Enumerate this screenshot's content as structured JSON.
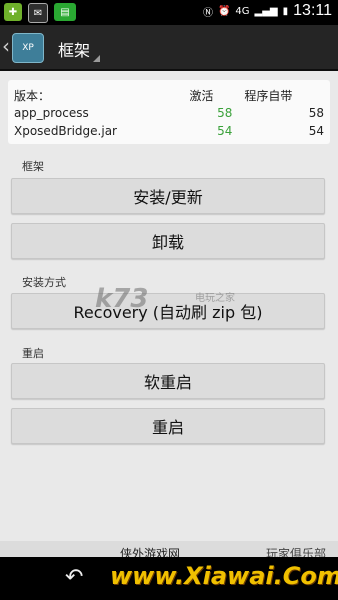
{
  "status_bar": {
    "signal_label": "4G",
    "time": "13:11",
    "icons": [
      "app-icon",
      "mail-icon",
      "news-icon",
      "nfc-icon",
      "alarm-icon",
      "signal-icon",
      "battery-icon"
    ]
  },
  "action_bar": {
    "title": "框架",
    "logo_text": "XP"
  },
  "versions": {
    "header": {
      "label": "版本：",
      "active": "激活",
      "installed": "程序自带"
    },
    "rows": [
      {
        "name": "app_process",
        "active": "58",
        "installed": "58"
      },
      {
        "name": "XposedBridge.jar",
        "active": "54",
        "installed": "54"
      }
    ]
  },
  "sections": {
    "framework": "框架",
    "install_method": "安装方式",
    "reboot": "重启"
  },
  "buttons": {
    "install_update": "安装/更新",
    "uninstall": "卸载",
    "recovery": "Recovery (自动刷 zip 包)",
    "soft_reboot": "软重启",
    "reboot": "重启"
  },
  "watermark": {
    "k73": "k73",
    "k73_sub": "电玩之家",
    "site_small": "侠外游戏网",
    "club": "玩家俱乐部",
    "url": "www.Xiawai.Com"
  },
  "colors": {
    "active_green": "#3aa13a",
    "action_bar": "#252525",
    "background": "#e9e9e9"
  }
}
